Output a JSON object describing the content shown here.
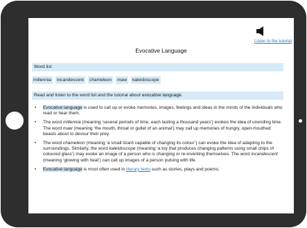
{
  "header": {
    "speaker_icon": "speaker-icon",
    "tutorial_link": "Listen to the tutorial",
    "title": "Evocative Language"
  },
  "word_list": {
    "heading": "Word list",
    "words": [
      "millennia",
      "incandescent",
      "chameleon",
      "maw",
      "kaleidoscope"
    ]
  },
  "instruction": {
    "text_before": "Read and listen to the word list and the tutorial about ",
    "highlight": "evocative language",
    "text_after": "."
  },
  "bullets": {
    "b1": {
      "highlight": "Evocative language",
      "text": " is used to call up or evoke memories, images, feelings and ideas in the minds of the individuals who read or hear them."
    },
    "b2": {
      "t1": "The word ",
      "w1": "millennia",
      "t2": " (meaning ‘several periods of time, each lasting a thousand years’) evokes the idea of unending time. The word ",
      "w2": "maw",
      "t3": " (meaning ‘the mouth, throat or gullet of an animal’) may call up memories of hungry, open-mouthed beasts about to devour their prey."
    },
    "b3": {
      "t1": "The word ",
      "w1": "chameleon",
      "t2": " (meaning ‘a small lizard capable of changing its colour’) can evoke the idea of adapting to the surroundings. Similarly, the word ",
      "w2": "kaleidoscope",
      "t3": " (meaning ‘a toy that produces changing patterns using small chips of coloured glass’) may evoke an image of a person who is changing or re-inventing themselves. The word ",
      "w3": "incandescent",
      "t4": " (meaning ‘glowing with heat’) can call up images of a person pulsing with life."
    },
    "b4": {
      "highlight": "Evocative language",
      "t1": " is most often used in ",
      "link": "literary texts",
      "t2": " such as stories, plays and poems."
    }
  }
}
